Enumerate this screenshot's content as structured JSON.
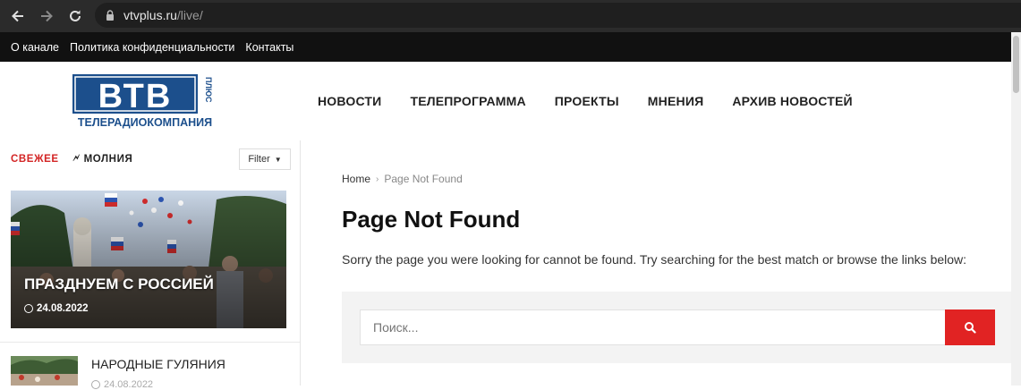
{
  "browser": {
    "url_host": "vtvplus.ru",
    "url_path": "/live/"
  },
  "topbar": {
    "links": [
      "О канале",
      "Политика конфиденциальности",
      "Контакты"
    ]
  },
  "logo": {
    "wordmark": "ВТВ",
    "plus": "ПЛЮС",
    "subtitle": "ТЕЛЕРАДИОКОМПАНИЯ"
  },
  "mainnav": [
    "НОВОСТИ",
    "ТЕЛЕПРОГРАММА",
    "ПРОЕКТЫ",
    "МНЕНИЯ",
    "АРХИВ НОВОСТЕЙ"
  ],
  "sidebar": {
    "tab_fresh": "СВЕЖЕЕ",
    "tab_bolt": "МОЛНИЯ",
    "filter_label": "Filter",
    "feature": {
      "title": "ПРАЗДНУЕМ С РОССИЕЙ",
      "date": "24.08.2022"
    },
    "item": {
      "title": "НАРОДНЫЕ ГУЛЯНИЯ",
      "date": "24.08.2022"
    }
  },
  "main": {
    "breadcrumb_home": "Home",
    "breadcrumb_current": "Page Not Found",
    "title": "Page Not Found",
    "message": "Sorry the page you were looking for cannot be found. Try searching for the best match or browse the links below:",
    "search_placeholder": "Поиск..."
  },
  "colors": {
    "accent_red": "#e12323",
    "logo_blue": "#1c4f8c",
    "topbar_bg": "#111111"
  }
}
